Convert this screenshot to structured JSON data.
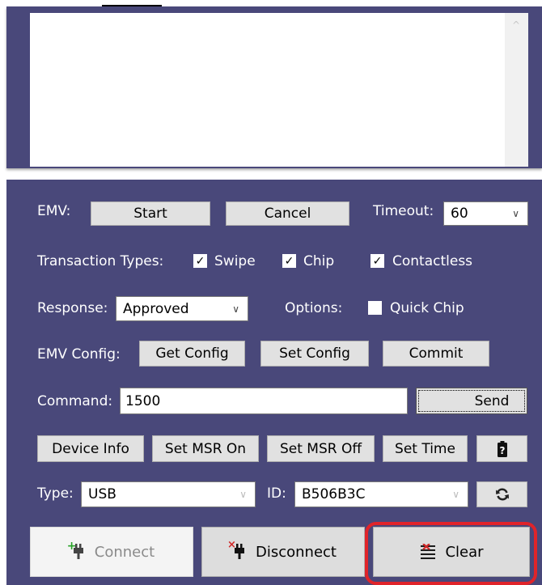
{
  "emv": {
    "label": "EMV:",
    "start_label": "Start",
    "cancel_label": "Cancel",
    "timeout_label": "Timeout:",
    "timeout_value": "60"
  },
  "transaction_types": {
    "label": "Transaction Types:",
    "options": [
      {
        "label": "Swipe",
        "checked": true
      },
      {
        "label": "Chip",
        "checked": true
      },
      {
        "label": "Contactless",
        "checked": true
      }
    ]
  },
  "response": {
    "label": "Response:",
    "value": "Approved",
    "options_label": "Options:",
    "quick_chip_label": "Quick Chip",
    "quick_chip_checked": false
  },
  "emv_config": {
    "label": "EMV Config:",
    "get_label": "Get Config",
    "set_label": "Set Config",
    "commit_label": "Commit"
  },
  "command": {
    "label": "Command:",
    "value": "1500",
    "send_label": "Send"
  },
  "device": {
    "info_label": "Device Info",
    "msr_on_label": "Set MSR On",
    "msr_off_label": "Set MSR Off",
    "set_time_label": "Set Time",
    "battery_icon": "battery-question-icon"
  },
  "connection": {
    "type_label": "Type:",
    "type_value": "USB",
    "id_label": "ID:",
    "id_value": "B506B3C",
    "refresh_icon": "refresh-icon"
  },
  "actions": {
    "connect_label": "Connect",
    "disconnect_label": "Disconnect",
    "clear_label": "Clear"
  },
  "colors": {
    "panel": "#49487a",
    "button": "#e1e1e1",
    "highlight": "#e0242a"
  }
}
